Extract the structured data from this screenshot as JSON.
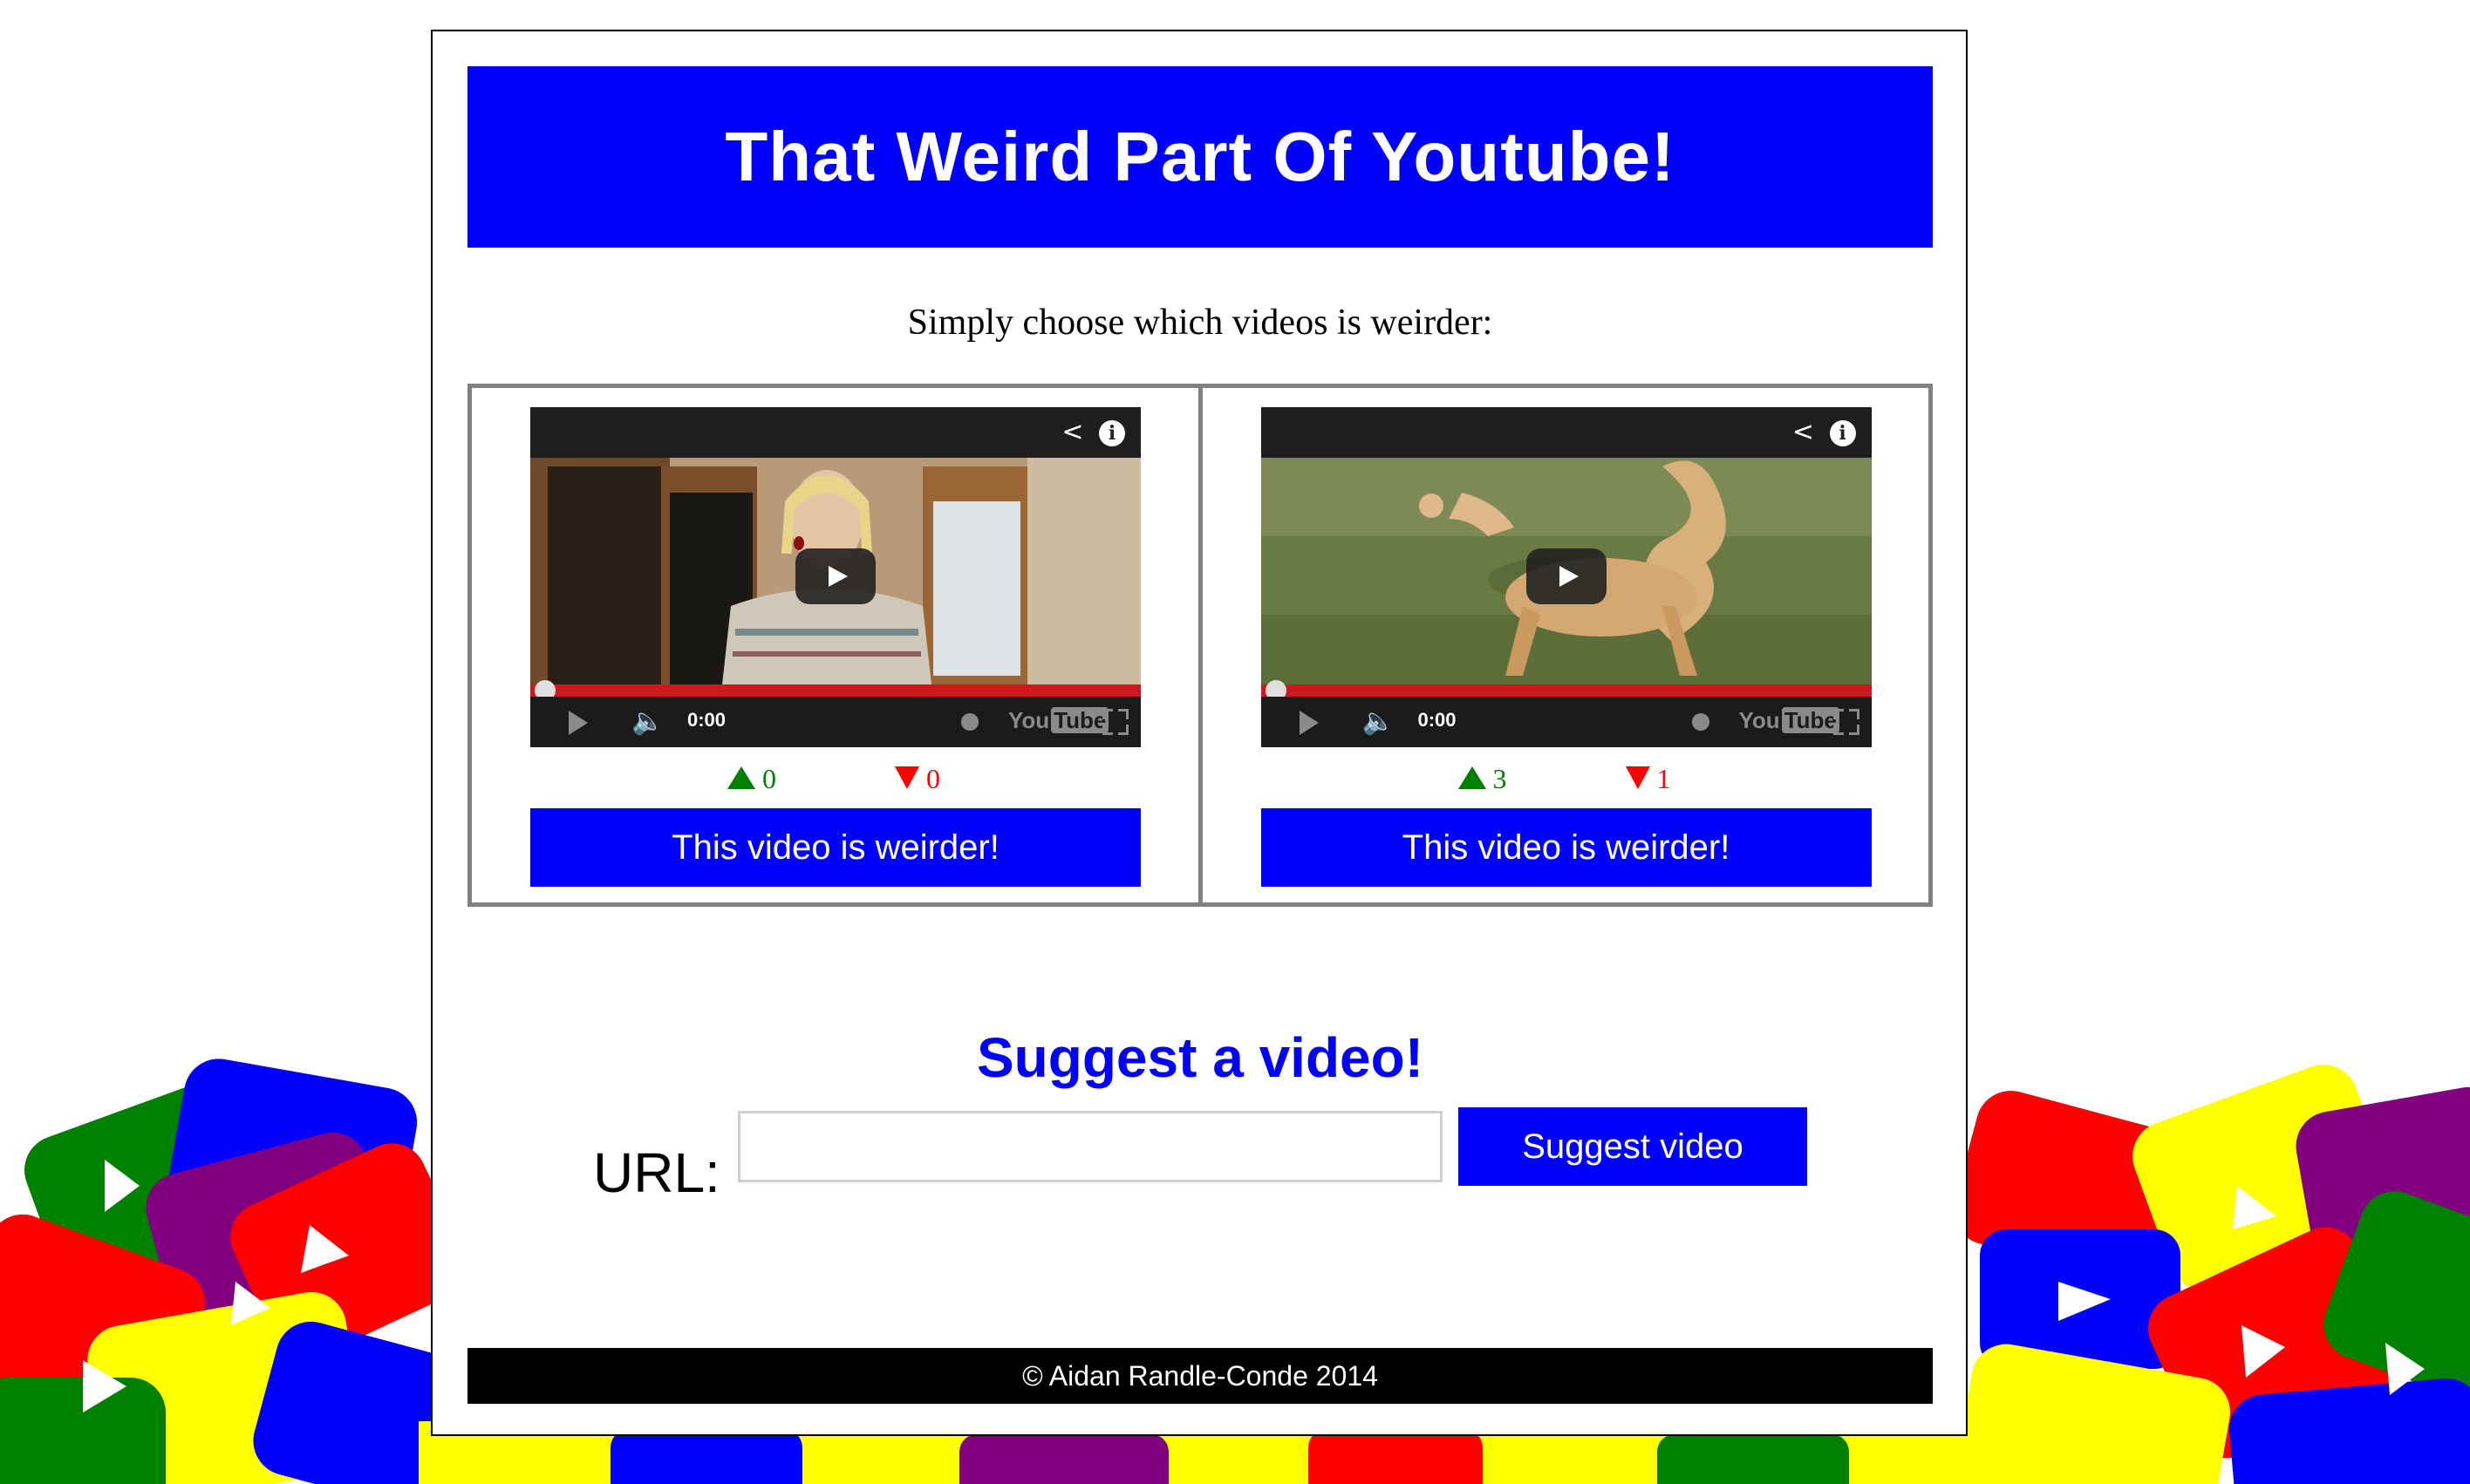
{
  "header": {
    "title": "That Weird Part Of Youtube!"
  },
  "instructions": "Simply choose which videos is weirder:",
  "videos": [
    {
      "time": "0:00",
      "upvotes": "0",
      "downvotes": "0",
      "button_label": "This video is weirder!",
      "youtube_label": "You",
      "youtube_tube": "Tube"
    },
    {
      "time": "0:00",
      "upvotes": "3",
      "downvotes": "1",
      "button_label": "This video is weirder!",
      "youtube_label": "You",
      "youtube_tube": "Tube"
    }
  ],
  "suggest": {
    "title": "Suggest a video!",
    "url_label": "URL:",
    "url_value": "",
    "button_label": "Suggest video"
  },
  "footer": {
    "text": "© Aidan Randle-Conde 2014"
  },
  "colors": {
    "brand_blue": "#0000ff",
    "upvote": "#008000",
    "downvote": "#ff0000",
    "progress_red": "#cc181e"
  },
  "icons": [
    "share-icon",
    "info-icon",
    "play-icon",
    "volume-icon",
    "clock-icon",
    "youtube-logo-icon",
    "fullscreen-icon",
    "upvote-icon",
    "downvote-icon"
  ]
}
